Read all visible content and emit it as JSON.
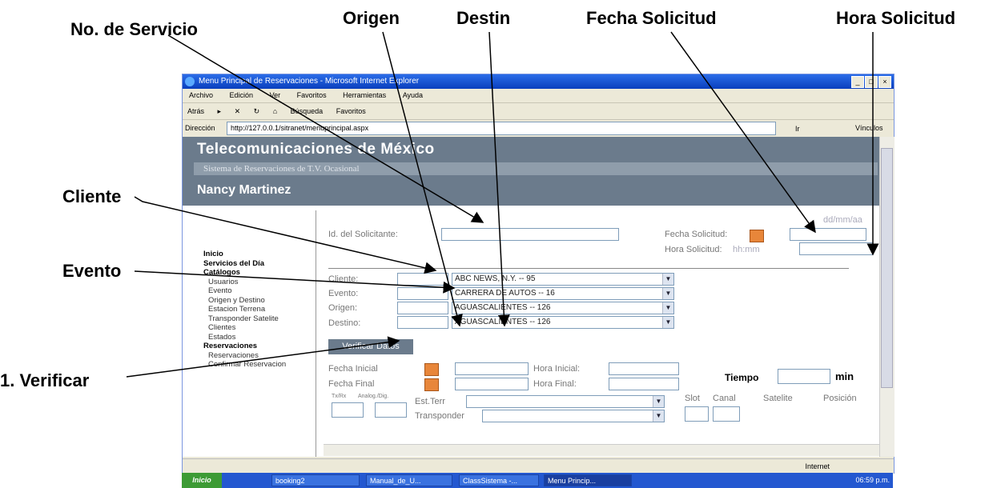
{
  "annotations": {
    "no_servicio": "No. de Servicio",
    "origen": "Origen",
    "destin": "Destin",
    "fecha_solicitud": "Fecha Solicitud",
    "hora_solicitud": "Hora Solicitud",
    "cliente": "Cliente",
    "evento": "Evento",
    "verificar": "1. Verificar"
  },
  "window": {
    "title": "Menu Principal de Reservaciones - Microsoft Internet Explorer",
    "menu": [
      "Archivo",
      "Edición",
      "Ver",
      "Favoritos",
      "Herramientas",
      "Ayuda"
    ],
    "toolbar": [
      "Atrás",
      "Búsqueda",
      "Favoritos"
    ],
    "address_label": "Dirección",
    "address": "http://127.0.0.1/sitranet/menuprincipal.aspx",
    "go": "Ir",
    "links": "Vínculos"
  },
  "header": {
    "company": "Telecomunicaciones de México",
    "system": "Sistema de Reservaciones de T.V. Ocasional",
    "user": "Nancy Martinez"
  },
  "sidebar": [
    "Inicio",
    "Servicios del Día",
    "Catálogos",
    "Usuarios",
    "Evento",
    "Origen y Destino",
    "Estacion Terrena",
    "Transponder Satelite",
    "Clientes",
    "Estados",
    "Reservaciones",
    "Reservaciones",
    "Confirmar Reservacion"
  ],
  "form": {
    "id_solicitante_label": "Id. del Solicitante:",
    "date_format": "dd/mm/aa",
    "fecha_solicitud_label": "Fecha Solicitud:",
    "hora_solicitud_label": "Hora Solicitud:",
    "hora_format": "hh:mm",
    "cliente_label": "Cliente:",
    "cliente_value": "ABC NEWS, N.Y. -- 95",
    "evento_label": "Evento:",
    "evento_value": "CARRERA DE AUTOS -- 16",
    "origen_label": "Origen:",
    "origen_value": "AGUASCALIENTES -- 126",
    "destino_label": "Destino:",
    "destino_value": "AGUASCALIENTES -- 126",
    "verify_button": "Verificar Datos",
    "fecha_inicial_label": "Fecha Inicial",
    "hora_inicial_label": "Hora Inicial:",
    "fecha_final_label": "Fecha Final",
    "hora_final_label": "Hora Final:",
    "tiempo_label": "Tiempo",
    "min_label": "min",
    "txrx_label": "Tx/Rx",
    "analog_label": "Analog./Dig.",
    "est_terr_label": "Est.Terr",
    "transponder_label": "Transponder",
    "slot_label": "Slot",
    "canal_label": "Canal",
    "satelite_label": "Satelite",
    "posicion_label": "Posición"
  },
  "status": {
    "zone": "Internet"
  },
  "taskbar": {
    "start": "Inicio",
    "tasks": [
      "booking2",
      "Manual_de_U...",
      "ClassSistema -...",
      "Menu Princip..."
    ],
    "clock": "06:59 p.m."
  }
}
